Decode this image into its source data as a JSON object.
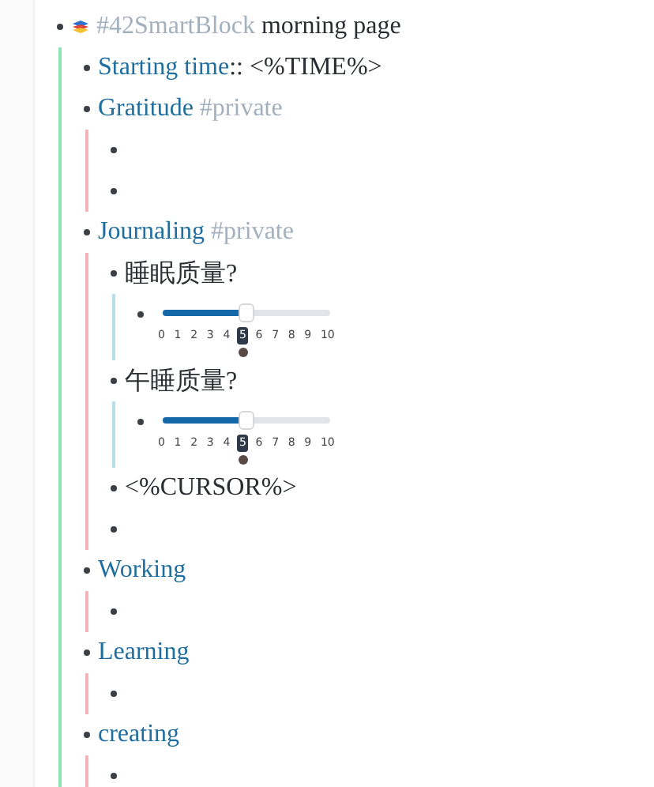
{
  "outline": {
    "kind": "text",
    "parts": [
      {
        "kind": "icon"
      },
      {
        "kind": "tag",
        "text": "#42SmartBlock"
      },
      {
        "kind": "text",
        "text": " morning page"
      }
    ],
    "children": [
      {
        "kind": "text",
        "parts": [
          {
            "kind": "link",
            "text": "Starting time"
          },
          {
            "kind": "text",
            "text": ":: <%TIME%>"
          }
        ]
      },
      {
        "kind": "text",
        "parts": [
          {
            "kind": "link",
            "text": "Gratitude"
          },
          {
            "kind": "tag",
            "text": " #private"
          }
        ],
        "children": [
          {
            "kind": "text"
          },
          {
            "kind": "text"
          }
        ]
      },
      {
        "kind": "text",
        "parts": [
          {
            "kind": "link",
            "text": "Journaling"
          },
          {
            "kind": "tag",
            "text": " #private"
          }
        ],
        "children": [
          {
            "kind": "text",
            "parts": [
              {
                "kind": "text",
                "text": "睡眠质量?"
              }
            ],
            "children": [
              {
                "kind": "slider",
                "level": 0.5,
                "ticks": [
                  {
                    "label": "0",
                    "selected": false
                  },
                  {
                    "label": "1",
                    "selected": false
                  },
                  {
                    "label": "2",
                    "selected": false
                  },
                  {
                    "label": "3",
                    "selected": false
                  },
                  {
                    "label": "4",
                    "selected": false
                  },
                  {
                    "label": "5",
                    "selected": true
                  },
                  {
                    "label": "6",
                    "selected": false
                  },
                  {
                    "label": "7",
                    "selected": false
                  },
                  {
                    "label": "8",
                    "selected": false
                  },
                  {
                    "label": "9",
                    "selected": false
                  },
                  {
                    "label": "10",
                    "selected": false
                  }
                ]
              }
            ]
          },
          {
            "kind": "text",
            "parts": [
              {
                "kind": "text",
                "text": "午睡质量?"
              }
            ],
            "children": [
              {
                "kind": "slider",
                "level": 0.5,
                "ticks": [
                  {
                    "label": "0",
                    "selected": false
                  },
                  {
                    "label": "1",
                    "selected": false
                  },
                  {
                    "label": "2",
                    "selected": false
                  },
                  {
                    "label": "3",
                    "selected": false
                  },
                  {
                    "label": "4",
                    "selected": false
                  },
                  {
                    "label": "5",
                    "selected": true
                  },
                  {
                    "label": "6",
                    "selected": false
                  },
                  {
                    "label": "7",
                    "selected": false
                  },
                  {
                    "label": "8",
                    "selected": false
                  },
                  {
                    "label": "9",
                    "selected": false
                  },
                  {
                    "label": "10",
                    "selected": false
                  }
                ]
              }
            ]
          },
          {
            "kind": "text",
            "parts": [
              {
                "kind": "text",
                "text": "<%CURSOR%>"
              }
            ]
          },
          {
            "kind": "text"
          }
        ]
      },
      {
        "kind": "text",
        "parts": [
          {
            "kind": "link",
            "text": "Working"
          }
        ],
        "children": [
          {
            "kind": "text"
          }
        ]
      },
      {
        "kind": "text",
        "parts": [
          {
            "kind": "link",
            "text": "Learning"
          }
        ],
        "children": [
          {
            "kind": "text"
          }
        ]
      },
      {
        "kind": "text",
        "parts": [
          {
            "kind": "link",
            "text": "creating"
          }
        ],
        "children": [
          {
            "kind": "text"
          }
        ]
      }
    ]
  }
}
